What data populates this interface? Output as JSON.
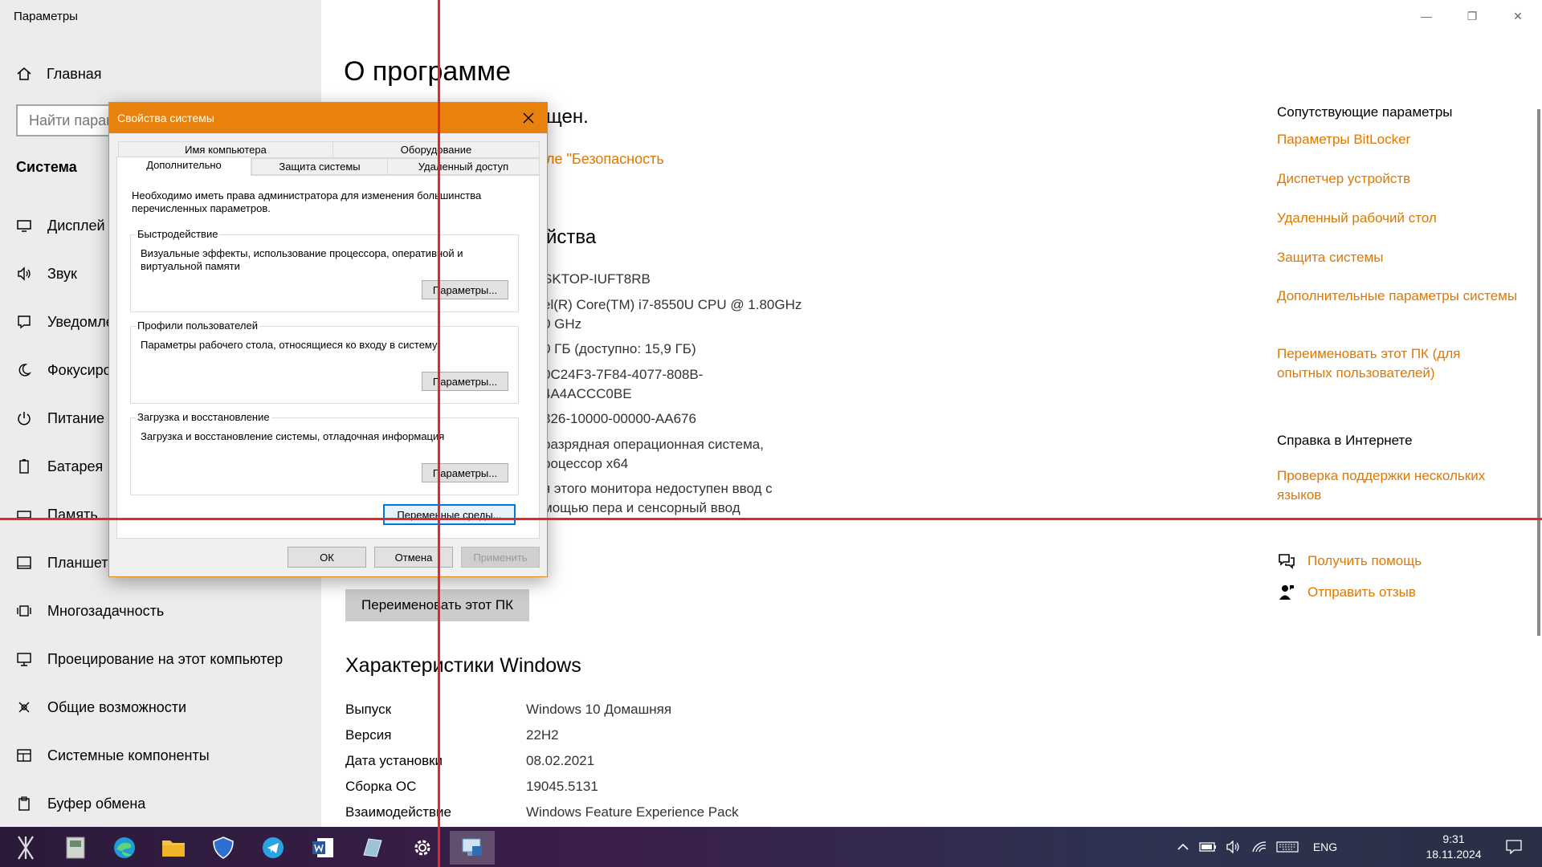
{
  "app": {
    "title": "Параметры",
    "home_label": "Главная",
    "search_placeholder": "Найти параметр",
    "section_title": "Система",
    "nav_items": [
      {
        "label": "Дисплей",
        "icon": "monitor-icon"
      },
      {
        "label": "Звук",
        "icon": "speaker-icon"
      },
      {
        "label": "Уведомления и действия",
        "icon": "notification-icon"
      },
      {
        "label": "Фокусировка внимания",
        "icon": "moon-icon"
      },
      {
        "label": "Питание и спящий режим",
        "icon": "power-icon"
      },
      {
        "label": "Батарея",
        "icon": "battery-icon"
      },
      {
        "label": "Память",
        "icon": "storage-icon"
      },
      {
        "label": "Планшет",
        "icon": "tablet-icon"
      },
      {
        "label": "Многозадачность",
        "icon": "multitask-icon"
      },
      {
        "label": "Проецирование на этот компьютер",
        "icon": "project-icon"
      },
      {
        "label": "Общие возможности",
        "icon": "shared-icon"
      },
      {
        "label": "Системные компоненты",
        "icon": "components-icon"
      },
      {
        "label": "Буфер обмена",
        "icon": "clipboard-icon"
      }
    ]
  },
  "window_controls": {
    "minimize": "—",
    "restore": "❐",
    "close": "✕"
  },
  "main": {
    "page_title": "О программе",
    "protect_text": "щен.",
    "security_link": "ле \"Безопасность",
    "device_specs_title": "йства",
    "device_specs_values": [
      "SKTOP-IUFT8RB",
      "el(R) Core(TM) i7-8550U CPU @ 1.80GHz\n0 GHz",
      "0 ГБ (доступно: 15,9 ГБ)",
      "0C24F3-7F84-4077-808B-\n4A4ACCC0BE",
      "326-10000-00000-AA676",
      "разрядная операционная система,\nроцессор x64",
      "я этого монитора недоступен ввод с\nмощью пера и сенсорный ввод"
    ],
    "rename_button": "Переименовать этот ПК",
    "windows_specs_title": "Характеристики Windows",
    "windows_specs": [
      {
        "label": "Выпуск",
        "value": "Windows 10 Домашняя"
      },
      {
        "label": "Версия",
        "value": "22H2"
      },
      {
        "label": "Дата установки",
        "value": "08.02.2021"
      },
      {
        "label": "Сборка ОС",
        "value": "19045.5131"
      },
      {
        "label": "Взаимодействие",
        "value": "Windows Feature Experience Pack"
      }
    ]
  },
  "related": {
    "title": "Сопутствующие параметры",
    "links": [
      "Параметры BitLocker",
      "Диспетчер устройств",
      "Удаленный рабочий стол",
      "Защита системы",
      "Дополнительные параметры системы",
      "Переименовать этот ПК (для опытных пользователей)"
    ],
    "web_help_title": "Справка в Интернете",
    "web_help_link": "Проверка поддержки нескольких языков",
    "get_help": "Получить помощь",
    "feedback": "Отправить отзыв"
  },
  "dialog": {
    "title": "Свойства системы",
    "tabs_row1": [
      "Имя компьютера",
      "Оборудование"
    ],
    "tabs_row2": [
      "Дополнительно",
      "Защита системы",
      "Удаленный доступ"
    ],
    "admin_note": "Необходимо иметь права администратора для изменения большинства перечисленных параметров.",
    "groups": [
      {
        "title": "Быстродействие",
        "desc": "Визуальные эффекты, использование процессора, оперативной и виртуальной памяти",
        "button": "Параметры..."
      },
      {
        "title": "Профили пользователей",
        "desc": "Параметры рабочего стола, относящиеся ко входу в систему",
        "button": "Параметры..."
      },
      {
        "title": "Загрузка и восстановление",
        "desc": "Загрузка и восстановление системы, отладочная информация",
        "button": "Параметры..."
      }
    ],
    "env_button": "Переменные среды...",
    "ok": "ОК",
    "cancel": "Отмена",
    "apply": "Применить"
  },
  "taskbar": {
    "apps": [
      "network-app-icon",
      "storage-app-icon",
      "edge-icon",
      "file-explorer-icon",
      "shield-app-icon",
      "telegram-icon",
      "word-icon",
      "notes-icon",
      "settings-icon",
      "system-properties-icon"
    ],
    "language": "ENG",
    "time": "9:31",
    "date": "18.11.2024"
  },
  "colors": {
    "accent": "#e07800",
    "dialog_title": "#e8820c",
    "guide_line": "#e3272d"
  }
}
